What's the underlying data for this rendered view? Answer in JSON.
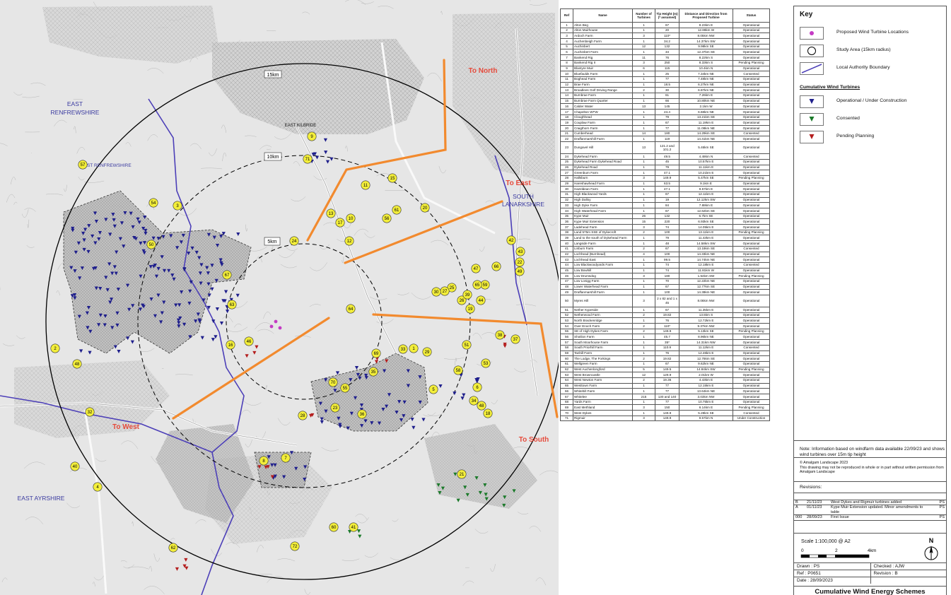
{
  "map": {
    "district_labels": {
      "east_renfrewshire": "EAST\nRENFREWSHIRE",
      "east_renfrewshire_small": "EAST RENFREWSHIRE",
      "south_lanarkshire": "SOUTH\nLANARKSHIRE",
      "east_ayrshire": "EAST AYRSHIRE",
      "east_kilbride": "EAST KILBRIDE"
    },
    "ring_labels": {
      "r15": "15km",
      "r10": "10km",
      "r5": "5km"
    },
    "direction_labels": {
      "north": "To North",
      "east": "To East",
      "west": "To West",
      "south": "To South"
    },
    "colors": {
      "orange": "#f28a2e",
      "direction_red": "#e64b3c",
      "marker_yellow": "#f3ee3a",
      "operational": "#1f1f8c",
      "consented": "#1b7a2a",
      "pending": "#b41e1e",
      "boundary": "#4c3fb8",
      "proposed": "#c43bc4"
    },
    "markers": [
      "1",
      "2",
      "3",
      "4",
      "5",
      "6",
      "7",
      "8",
      "9",
      "10",
      "11",
      "12",
      "13",
      "15",
      "16",
      "17",
      "18",
      "19",
      "20",
      "21",
      "22",
      "23",
      "24",
      "25",
      "26",
      "27",
      "28",
      "29",
      "30",
      "32",
      "33",
      "34",
      "35",
      "36",
      "37",
      "38",
      "39",
      "40",
      "41",
      "42",
      "43",
      "44",
      "46",
      "47",
      "48",
      "48",
      "49",
      "50",
      "51",
      "53",
      "54",
      "55",
      "56",
      "57",
      "58",
      "59",
      "60",
      "61",
      "62",
      "63",
      "64",
      "65",
      "66",
      "67",
      "69",
      "70",
      "71",
      "72"
    ]
  },
  "schedule": {
    "headers": [
      "Ref",
      "Name",
      "Number of Turbines",
      "Tip Height (m) (* assumed)",
      "Distance and Direction from Proposed Turbine",
      "Status"
    ],
    "rows": [
      [
        "1",
        "Alton Beg",
        "1",
        "67",
        "8.23km E",
        "Operational"
      ],
      [
        "2",
        "Alton Muirhouse",
        "1",
        "20",
        "12.88km W",
        "Operational"
      ],
      [
        "3",
        "Ardoch Farm",
        "3",
        "110*",
        "8.05km NW",
        "Operational"
      ],
      [
        "4",
        "Auchenbeigh Farm",
        "1",
        "34.2",
        "14.37km SW",
        "Operational"
      ],
      [
        "5",
        "Auchinbert",
        "12",
        "132",
        "9.98km SE",
        "Operational"
      ],
      [
        "6",
        "Auchinbert Farm",
        "1",
        "34",
        "12.37km SE",
        "Operational"
      ],
      [
        "7",
        "Bankend Rig",
        "11",
        "76",
        "8.22km S",
        "Operational"
      ],
      [
        "8",
        "Bankend Rig II",
        "3",
        "250",
        "8.33km S",
        "Pending Planning"
      ],
      [
        "9",
        "Blantyre Muir",
        "6",
        "115",
        "10.4km N",
        "Operational"
      ],
      [
        "10",
        "Bluefaulds Farm",
        "1",
        "25",
        "7.34km NE",
        "Consented"
      ],
      [
        "11",
        "Boghead Farm",
        "1",
        "77",
        "7.48km NE",
        "Operational"
      ],
      [
        "12",
        "Brae Farm",
        "1",
        "18.5",
        "6.27km NE",
        "Operational"
      ],
      [
        "13",
        "Broadlees Golf Driving Range",
        "2",
        "30",
        "6.87km NE",
        "Operational"
      ],
      [
        "14",
        "Burnbrae Farm",
        "1",
        "61",
        "7.26km E",
        "Operational"
      ],
      [
        "15",
        "Burnbrae Farm Quarter",
        "1",
        "66",
        "10.80km NE",
        "Operational"
      ],
      [
        "16",
        "Calder Water",
        "13",
        "145",
        "2.1km W",
        "Operational"
      ],
      [
        "17",
        "Chapelton WTW",
        "1",
        "24.4",
        "6.68km NE",
        "Operational"
      ],
      [
        "18",
        "Cloughhead",
        "1",
        "79",
        "13.21km SE",
        "Operational"
      ],
      [
        "19",
        "Couplaw Farm",
        "1",
        "67",
        "11.19km E",
        "Operational"
      ],
      [
        "20",
        "Craigthorn Farm",
        "1",
        "77",
        "11.08km NE",
        "Operational"
      ],
      [
        "21",
        "Cumberhead",
        "14",
        "180",
        "14.29km SE",
        "Consented"
      ],
      [
        "22",
        "Draffanmarshill Farm",
        "1",
        "119",
        "14.41km NE",
        "Operational"
      ],
      [
        "23",
        "Dungavel Hill",
        "13",
        "121.2 and 101.2",
        "5.46km SE",
        "Operational"
      ],
      [
        "24",
        "Dykehead Farm",
        "1",
        "49.5",
        "4.48km N",
        "Consented"
      ],
      [
        "25",
        "Dykehead Farm Dykehead Road",
        "1",
        "45",
        "10.57km E",
        "Operational"
      ],
      [
        "26",
        "Dykehead Road",
        "1",
        "79",
        "11.11km E",
        "Operational"
      ],
      [
        "27",
        "Greenburn Farm",
        "1",
        "47.1",
        "10.21km E",
        "Operational"
      ],
      [
        "28",
        "Hallsburn",
        "3",
        "149.9",
        "5.47km SE",
        "Pending Planning"
      ],
      [
        "29",
        "Hareshawhead Farm",
        "1",
        "63.5",
        "9.1km E",
        "Operational"
      ],
      [
        "30",
        "Hazeldean Farm",
        "1",
        "47.1",
        "9.57km E",
        "Operational"
      ],
      [
        "31",
        "High Blackwood Yards",
        "1",
        "67",
        "12.11km E",
        "Operational"
      ],
      [
        "32",
        "High Dalloy",
        "1",
        "19",
        "12.12km SW",
        "Operational"
      ],
      [
        "33",
        "High Dyke Farm",
        "1",
        "84",
        "7.88km E",
        "Operational"
      ],
      [
        "34",
        "High Waterhead Farm",
        "1",
        "67",
        "12.62km SE",
        "Operational"
      ],
      [
        "35",
        "Kype Muir",
        "26",
        "132",
        "6.7km SE",
        "Operational"
      ],
      [
        "36",
        "Kype Muir Extension",
        "15",
        "220",
        "6.93km SE",
        "Operational"
      ],
      [
        "37",
        "Ladehead Farm",
        "3",
        "74",
        "14.05km E",
        "Operational"
      ],
      [
        "38",
        "Land 575m SSE of Dykecroft",
        "2",
        "100",
        "13.11km E",
        "Pending Planning"
      ],
      [
        "39",
        "Land to the south of Dykehead Farm",
        "1",
        "79",
        "11.43km E",
        "Operational"
      ],
      [
        "40",
        "Langside Farm",
        "1",
        "48",
        "14.58km SW",
        "Operational"
      ],
      [
        "41",
        "Linburn Farm",
        "2",
        "67",
        "13.18km SE",
        "Consented"
      ],
      [
        "42",
        "Lochhead (Burnhead)",
        "4",
        "100",
        "14.33km NE",
        "Operational"
      ],
      [
        "43",
        "Lochhead East",
        "1",
        "99.5",
        "14.74km NE",
        "Operational"
      ],
      [
        "44",
        "Low Blackwoodyards Farm",
        "1",
        "74",
        "12.18km E",
        "Consented"
      ],
      [
        "45",
        "Low Bowhill",
        "1",
        "74",
        "11.81km W",
        "Operational"
      ],
      [
        "46",
        "Low Drumsdog",
        "3",
        "180",
        "1.54km SW",
        "Pending Planning"
      ],
      [
        "47",
        "Low Lonigg Farm",
        "1",
        "70",
        "12.22km NE",
        "Operational"
      ],
      [
        "48",
        "Lower Waterhead Farm",
        "1",
        "67",
        "12.77km SE",
        "Operational"
      ],
      [
        "49",
        "Draffanmarshill Farm",
        "1",
        "100",
        "14.38km NE",
        "Operational"
      ],
      [
        "50",
        "Myres Hill",
        "3",
        "2 x 82 and 1 x 45",
        "8.06km NW",
        "Operational"
      ],
      [
        "51",
        "Nether Kypeside",
        "1",
        "67",
        "11.35km E",
        "Operational"
      ],
      [
        "52",
        "Netherwood Farm",
        "2",
        "19.82",
        "13.5km S",
        "Operational"
      ],
      [
        "53",
        "North Brackenridge",
        "1",
        "76",
        "12.72km E",
        "Operational"
      ],
      [
        "54",
        "Over Enoch Farm",
        "2",
        "110*",
        "9.37km NW",
        "Operational"
      ],
      [
        "55",
        "SE of High Dykes Farm",
        "2",
        "149.9",
        "5.13km SE",
        "Pending Planning"
      ],
      [
        "56",
        "Shotlion Farm",
        "1",
        "45.7",
        "8.96km NE",
        "Operational"
      ],
      [
        "57",
        "South Moorhouse Farm",
        "1",
        "35*",
        "14.31km NW",
        "Operational"
      ],
      [
        "58",
        "South Priorhill Farm",
        "1",
        "110.9",
        "11.12km E",
        "Consented"
      ],
      [
        "59",
        "Tanhill Farm",
        "1",
        "76",
        "12.46km E",
        "Operational"
      ],
      [
        "60",
        "The Lodge, The Forkings",
        "2",
        "19.82",
        "12.76km SE",
        "Operational"
      ],
      [
        "61",
        "Wellgreen Farm",
        "1",
        "67",
        "9.62km NE",
        "Operational"
      ],
      [
        "62",
        "West Auchenlongford",
        "5",
        "149.5",
        "14.84km SW",
        "Pending Planning"
      ],
      [
        "63",
        "West Browncastle",
        "12",
        "129.9",
        "2.01km W",
        "Operational"
      ],
      [
        "64",
        "West Newton Farm",
        "2",
        "19.36",
        "4.43km E",
        "Operational"
      ],
      [
        "65",
        "Westtown Farm",
        "1",
        "77",
        "12.15km E",
        "Operational"
      ],
      [
        "66",
        "Whitehill Farm",
        "1",
        "77",
        "13.64km NE",
        "Operational"
      ],
      [
        "67",
        "Whitelee",
        "215",
        "130 and 140",
        "3.03km NW",
        "Operational"
      ],
      [
        "68",
        "Yards Farm",
        "1",
        "77",
        "10.75km E",
        "Operational"
      ],
      [
        "69",
        "East Methland",
        "3",
        "150",
        "6.14km E",
        "Pending Planning"
      ],
      [
        "70",
        "West Dykes",
        "1",
        "149.9",
        "5.28km SE",
        "Consented"
      ],
      [
        "71",
        "Rigmuir",
        "3",
        "149.9",
        "9.57km N",
        "Under Construction"
      ]
    ]
  },
  "key": {
    "title": "Key",
    "items": [
      {
        "label": "Proposed Wind Turbine Locations"
      },
      {
        "label": "Study Area (15km radius)"
      },
      {
        "label": "Local Authority Boundary"
      }
    ],
    "cumulative_title": "Cumulative Wind Turbines",
    "cumulative_items": [
      {
        "label": "Operational / Under Construction"
      },
      {
        "label": "Consented"
      },
      {
        "label": "Pending Planning"
      }
    ]
  },
  "note": "Note: Information based on windfarm data available 22/09/23 and shows wind turbines over 15m tip height",
  "copyright": {
    "line1": "© Amalgam Landscape 2023",
    "line2": "This drawing may not be reproduced in whole or in part without written permission from Amalgam Landscape"
  },
  "revisions": {
    "title": "Revisions:",
    "rows": [
      [
        "B",
        "21/11/23",
        "West Dykes and Rigmuir turbines added",
        "PS"
      ],
      [
        "A",
        "01/11/23",
        "Kype Muir Extension updated. Minor amendments to table",
        "PS"
      ],
      [
        "000",
        "28/09/23",
        "First Issue",
        "PS"
      ]
    ]
  },
  "scale": {
    "text": "Scale    1:100,000 @ A2",
    "t0": "0",
    "t2": "2",
    "t4": "4km",
    "north": "N"
  },
  "drawn": {
    "drawn": "Drawn : PS",
    "checked": "Checked : AJW",
    "ref": "Ref :      P0651",
    "revision": "Revision :  B",
    "date": "Date :   28/09/2023"
  },
  "drawing_title": "Cumulative Wind Energy Schemes"
}
